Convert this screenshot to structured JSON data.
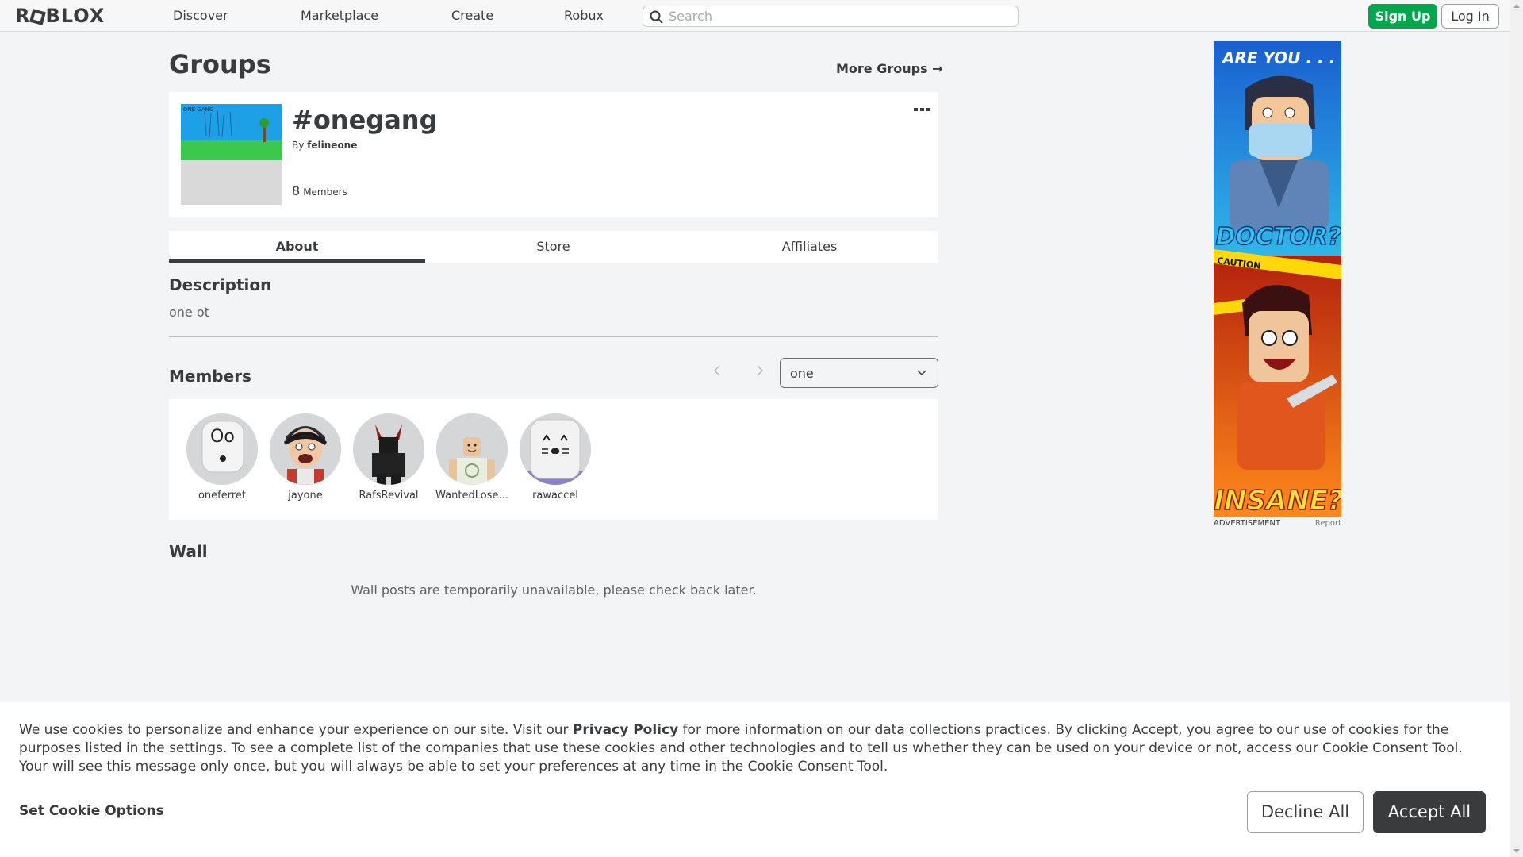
{
  "header": {
    "logo": "ROBLOX",
    "nav": [
      "Discover",
      "Marketplace",
      "Create",
      "Robux"
    ],
    "search_placeholder": "Search",
    "signup_label": "Sign Up",
    "login_label": "Log In"
  },
  "page": {
    "title": "Groups",
    "more_groups_label": "More Groups →"
  },
  "group": {
    "name": "#onegang",
    "by_prefix": "By",
    "owner": "felineone",
    "member_count": "8",
    "members_label": "Members",
    "emblem_text": "ONE GANG"
  },
  "tabs": [
    "About",
    "Store",
    "Affiliates"
  ],
  "description": {
    "title": "Description",
    "text": "one ot"
  },
  "members": {
    "title": "Members",
    "role_selected": "one",
    "list": [
      "oneferret",
      "jayone",
      "RafsRevival",
      "WantedLose...",
      "rawaccel"
    ]
  },
  "wall": {
    "title": "Wall",
    "message": "Wall posts are temporarily unavailable, please check back later."
  },
  "ad": {
    "top_text": "ARE YOU . . .",
    "mid_text": "DOCTOR?",
    "tape_text": "CAUTION",
    "bottom_text": "INSANE?",
    "label": "ADVERTISEMENT",
    "report_label": "Report"
  },
  "cookie_banner": {
    "text_before": "We use cookies to personalize and enhance your experience on our site. Visit our ",
    "privacy_link": "Privacy Policy",
    "text_after": " for more information on our data collections practices. By clicking Accept, you agree to our use of cookies for the purposes listed in the settings. To see a complete list of the companies that use these cookies and other technologies and to tell us whether they can be used on your device or not, access our Cookie Consent Tool. Your will see this message only once, but you will always be able to set your preferences at any time in the Cookie Consent Tool.",
    "options_label": "Set Cookie Options",
    "decline_label": "Decline All",
    "accept_label": "Accept All"
  },
  "colors": {
    "brand_green": "#00a74d",
    "text_dark": "#393b3d",
    "page_bg": "#f2f4f5"
  }
}
